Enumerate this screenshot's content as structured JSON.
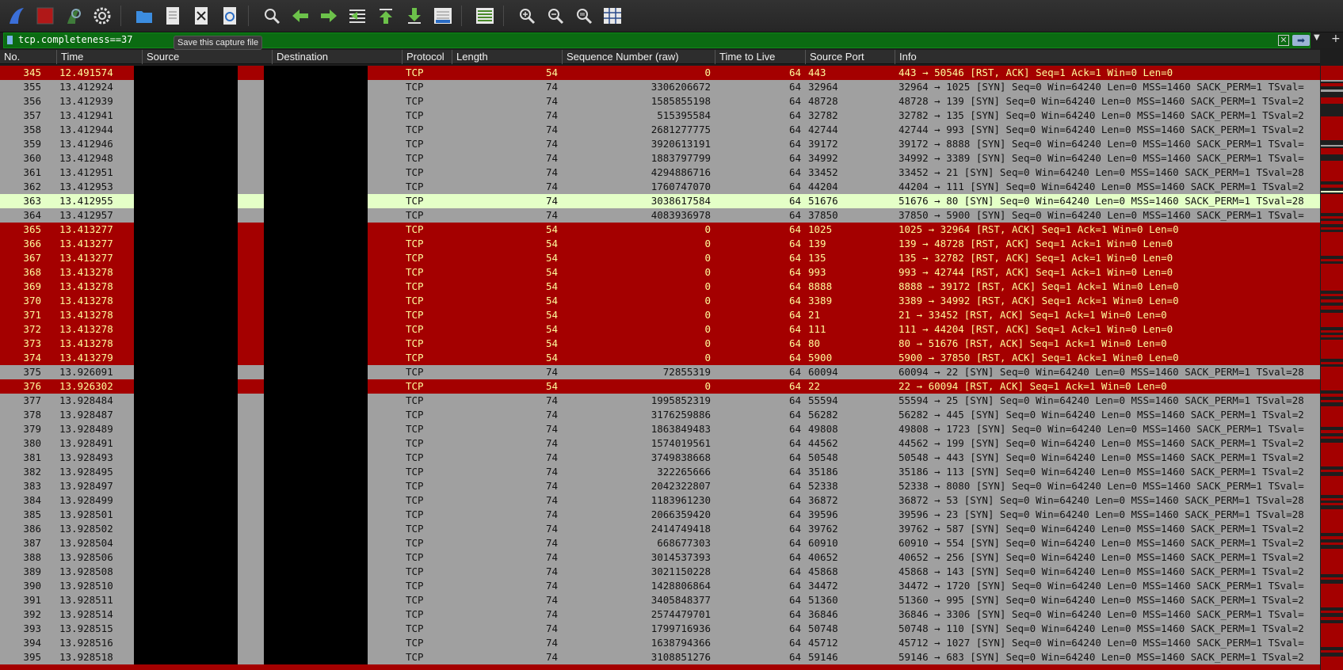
{
  "toolbar": {
    "tooltip": "Save this capture file",
    "icons": [
      "shark-fin-icon",
      "stop-icon",
      "restart-icon",
      "options-gear-icon",
      "open-folder-icon",
      "save-file-icon",
      "close-file-icon",
      "reload-icon",
      "find-icon",
      "back-arrow-icon",
      "forward-arrow-icon",
      "goto-packet-icon",
      "first-packet-icon",
      "last-packet-icon",
      "autoscroll-icon",
      "colorize-icon",
      "zoom-in-icon",
      "zoom-out-icon",
      "zoom-normal-icon",
      "resize-columns-icon"
    ]
  },
  "filter": {
    "value": "tcp.completeness==37"
  },
  "columns": [
    "No.",
    "Time",
    "Source",
    "Destination",
    "Protocol",
    "Length",
    "Sequence Number (raw)",
    "Time to Live",
    "Source Port",
    "Info"
  ],
  "colors": {
    "syn_bg": "#a0a0a0",
    "rst_bg": "#a40000",
    "rst_fg": "#fffc9c",
    "selected_bg": "#e4ffc7",
    "filter_bg": "#0b6b12"
  },
  "rows": [
    {
      "no": "345",
      "time": "12.491574",
      "proto": "TCP",
      "len": "54",
      "seq": "0",
      "ttl": "64",
      "sport": "443",
      "info": "443 → 50546 [RST, ACK] Seq=1 Ack=1 Win=0 Len=0",
      "type": "rst"
    },
    {
      "no": "355",
      "time": "13.412924",
      "proto": "TCP",
      "len": "74",
      "seq": "3306206672",
      "ttl": "64",
      "sport": "32964",
      "info": "32964 → 1025 [SYN] Seq=0 Win=64240 Len=0 MSS=1460 SACK_PERM=1 TSval=",
      "type": "syn"
    },
    {
      "no": "356",
      "time": "13.412939",
      "proto": "TCP",
      "len": "74",
      "seq": "1585855198",
      "ttl": "64",
      "sport": "48728",
      "info": "48728 → 139 [SYN] Seq=0 Win=64240 Len=0 MSS=1460 SACK_PERM=1 TSval=2",
      "type": "syn"
    },
    {
      "no": "357",
      "time": "13.412941",
      "proto": "TCP",
      "len": "74",
      "seq": "515395584",
      "ttl": "64",
      "sport": "32782",
      "info": "32782 → 135 [SYN] Seq=0 Win=64240 Len=0 MSS=1460 SACK_PERM=1 TSval=2",
      "type": "syn"
    },
    {
      "no": "358",
      "time": "13.412944",
      "proto": "TCP",
      "len": "74",
      "seq": "2681277775",
      "ttl": "64",
      "sport": "42744",
      "info": "42744 → 993 [SYN] Seq=0 Win=64240 Len=0 MSS=1460 SACK_PERM=1 TSval=2",
      "type": "syn"
    },
    {
      "no": "359",
      "time": "13.412946",
      "proto": "TCP",
      "len": "74",
      "seq": "3920613191",
      "ttl": "64",
      "sport": "39172",
      "info": "39172 → 8888 [SYN] Seq=0 Win=64240 Len=0 MSS=1460 SACK_PERM=1 TSval=",
      "type": "syn"
    },
    {
      "no": "360",
      "time": "13.412948",
      "proto": "TCP",
      "len": "74",
      "seq": "1883797799",
      "ttl": "64",
      "sport": "34992",
      "info": "34992 → 3389 [SYN] Seq=0 Win=64240 Len=0 MSS=1460 SACK_PERM=1 TSval=",
      "type": "syn"
    },
    {
      "no": "361",
      "time": "13.412951",
      "proto": "TCP",
      "len": "74",
      "seq": "4294886716",
      "ttl": "64",
      "sport": "33452",
      "info": "33452 → 21 [SYN] Seq=0 Win=64240 Len=0 MSS=1460 SACK_PERM=1 TSval=28",
      "type": "syn"
    },
    {
      "no": "362",
      "time": "13.412953",
      "proto": "TCP",
      "len": "74",
      "seq": "1760747070",
      "ttl": "64",
      "sport": "44204",
      "info": "44204 → 111 [SYN] Seq=0 Win=64240 Len=0 MSS=1460 SACK_PERM=1 TSval=2",
      "type": "syn"
    },
    {
      "no": "363",
      "time": "13.412955",
      "proto": "TCP",
      "len": "74",
      "seq": "3038617584",
      "ttl": "64",
      "sport": "51676",
      "info": "51676 → 80 [SYN] Seq=0 Win=64240 Len=0 MSS=1460 SACK_PERM=1 TSval=28",
      "type": "sel"
    },
    {
      "no": "364",
      "time": "13.412957",
      "proto": "TCP",
      "len": "74",
      "seq": "4083936978",
      "ttl": "64",
      "sport": "37850",
      "info": "37850 → 5900 [SYN] Seq=0 Win=64240 Len=0 MSS=1460 SACK_PERM=1 TSval=",
      "type": "syn"
    },
    {
      "no": "365",
      "time": "13.413277",
      "proto": "TCP",
      "len": "54",
      "seq": "0",
      "ttl": "64",
      "sport": "1025",
      "info": "1025 → 32964 [RST, ACK] Seq=1 Ack=1 Win=0 Len=0",
      "type": "rst"
    },
    {
      "no": "366",
      "time": "13.413277",
      "proto": "TCP",
      "len": "54",
      "seq": "0",
      "ttl": "64",
      "sport": "139",
      "info": "139 → 48728 [RST, ACK] Seq=1 Ack=1 Win=0 Len=0",
      "type": "rst"
    },
    {
      "no": "367",
      "time": "13.413277",
      "proto": "TCP",
      "len": "54",
      "seq": "0",
      "ttl": "64",
      "sport": "135",
      "info": "135 → 32782 [RST, ACK] Seq=1 Ack=1 Win=0 Len=0",
      "type": "rst"
    },
    {
      "no": "368",
      "time": "13.413278",
      "proto": "TCP",
      "len": "54",
      "seq": "0",
      "ttl": "64",
      "sport": "993",
      "info": "993 → 42744 [RST, ACK] Seq=1 Ack=1 Win=0 Len=0",
      "type": "rst"
    },
    {
      "no": "369",
      "time": "13.413278",
      "proto": "TCP",
      "len": "54",
      "seq": "0",
      "ttl": "64",
      "sport": "8888",
      "info": "8888 → 39172 [RST, ACK] Seq=1 Ack=1 Win=0 Len=0",
      "type": "rst"
    },
    {
      "no": "370",
      "time": "13.413278",
      "proto": "TCP",
      "len": "54",
      "seq": "0",
      "ttl": "64",
      "sport": "3389",
      "info": "3389 → 34992 [RST, ACK] Seq=1 Ack=1 Win=0 Len=0",
      "type": "rst"
    },
    {
      "no": "371",
      "time": "13.413278",
      "proto": "TCP",
      "len": "54",
      "seq": "0",
      "ttl": "64",
      "sport": "21",
      "info": "21 → 33452 [RST, ACK] Seq=1 Ack=1 Win=0 Len=0",
      "type": "rst"
    },
    {
      "no": "372",
      "time": "13.413278",
      "proto": "TCP",
      "len": "54",
      "seq": "0",
      "ttl": "64",
      "sport": "111",
      "info": "111 → 44204 [RST, ACK] Seq=1 Ack=1 Win=0 Len=0",
      "type": "rst"
    },
    {
      "no": "373",
      "time": "13.413278",
      "proto": "TCP",
      "len": "54",
      "seq": "0",
      "ttl": "64",
      "sport": "80",
      "info": "80 → 51676 [RST, ACK] Seq=1 Ack=1 Win=0 Len=0",
      "type": "rst"
    },
    {
      "no": "374",
      "time": "13.413279",
      "proto": "TCP",
      "len": "54",
      "seq": "0",
      "ttl": "64",
      "sport": "5900",
      "info": "5900 → 37850 [RST, ACK] Seq=1 Ack=1 Win=0 Len=0",
      "type": "rst"
    },
    {
      "no": "375",
      "time": "13.926091",
      "proto": "TCP",
      "len": "74",
      "seq": "72855319",
      "ttl": "64",
      "sport": "60094",
      "info": "60094 → 22 [SYN] Seq=0 Win=64240 Len=0 MSS=1460 SACK_PERM=1 TSval=28",
      "type": "syn"
    },
    {
      "no": "376",
      "time": "13.926302",
      "proto": "TCP",
      "len": "54",
      "seq": "0",
      "ttl": "64",
      "sport": "22",
      "info": "22 → 60094 [RST, ACK] Seq=1 Ack=1 Win=0 Len=0",
      "type": "rst"
    },
    {
      "no": "377",
      "time": "13.928484",
      "proto": "TCP",
      "len": "74",
      "seq": "1995852319",
      "ttl": "64",
      "sport": "55594",
      "info": "55594 → 25 [SYN] Seq=0 Win=64240 Len=0 MSS=1460 SACK_PERM=1 TSval=28",
      "type": "syn"
    },
    {
      "no": "378",
      "time": "13.928487",
      "proto": "TCP",
      "len": "74",
      "seq": "3176259886",
      "ttl": "64",
      "sport": "56282",
      "info": "56282 → 445 [SYN] Seq=0 Win=64240 Len=0 MSS=1460 SACK_PERM=1 TSval=2",
      "type": "syn"
    },
    {
      "no": "379",
      "time": "13.928489",
      "proto": "TCP",
      "len": "74",
      "seq": "1863849483",
      "ttl": "64",
      "sport": "49808",
      "info": "49808 → 1723 [SYN] Seq=0 Win=64240 Len=0 MSS=1460 SACK_PERM=1 TSval=",
      "type": "syn"
    },
    {
      "no": "380",
      "time": "13.928491",
      "proto": "TCP",
      "len": "74",
      "seq": "1574019561",
      "ttl": "64",
      "sport": "44562",
      "info": "44562 → 199 [SYN] Seq=0 Win=64240 Len=0 MSS=1460 SACK_PERM=1 TSval=2",
      "type": "syn"
    },
    {
      "no": "381",
      "time": "13.928493",
      "proto": "TCP",
      "len": "74",
      "seq": "3749838668",
      "ttl": "64",
      "sport": "50548",
      "info": "50548 → 443 [SYN] Seq=0 Win=64240 Len=0 MSS=1460 SACK_PERM=1 TSval=2",
      "type": "syn"
    },
    {
      "no": "382",
      "time": "13.928495",
      "proto": "TCP",
      "len": "74",
      "seq": "322265666",
      "ttl": "64",
      "sport": "35186",
      "info": "35186 → 113 [SYN] Seq=0 Win=64240 Len=0 MSS=1460 SACK_PERM=1 TSval=2",
      "type": "syn"
    },
    {
      "no": "383",
      "time": "13.928497",
      "proto": "TCP",
      "len": "74",
      "seq": "2042322807",
      "ttl": "64",
      "sport": "52338",
      "info": "52338 → 8080 [SYN] Seq=0 Win=64240 Len=0 MSS=1460 SACK_PERM=1 TSval=",
      "type": "syn"
    },
    {
      "no": "384",
      "time": "13.928499",
      "proto": "TCP",
      "len": "74",
      "seq": "1183961230",
      "ttl": "64",
      "sport": "36872",
      "info": "36872 → 53 [SYN] Seq=0 Win=64240 Len=0 MSS=1460 SACK_PERM=1 TSval=28",
      "type": "syn"
    },
    {
      "no": "385",
      "time": "13.928501",
      "proto": "TCP",
      "len": "74",
      "seq": "2066359420",
      "ttl": "64",
      "sport": "39596",
      "info": "39596 → 23 [SYN] Seq=0 Win=64240 Len=0 MSS=1460 SACK_PERM=1 TSval=28",
      "type": "syn"
    },
    {
      "no": "386",
      "time": "13.928502",
      "proto": "TCP",
      "len": "74",
      "seq": "2414749418",
      "ttl": "64",
      "sport": "39762",
      "info": "39762 → 587 [SYN] Seq=0 Win=64240 Len=0 MSS=1460 SACK_PERM=1 TSval=2",
      "type": "syn"
    },
    {
      "no": "387",
      "time": "13.928504",
      "proto": "TCP",
      "len": "74",
      "seq": "668677303",
      "ttl": "64",
      "sport": "60910",
      "info": "60910 → 554 [SYN] Seq=0 Win=64240 Len=0 MSS=1460 SACK_PERM=1 TSval=2",
      "type": "syn"
    },
    {
      "no": "388",
      "time": "13.928506",
      "proto": "TCP",
      "len": "74",
      "seq": "3014537393",
      "ttl": "64",
      "sport": "40652",
      "info": "40652 → 256 [SYN] Seq=0 Win=64240 Len=0 MSS=1460 SACK_PERM=1 TSval=2",
      "type": "syn"
    },
    {
      "no": "389",
      "time": "13.928508",
      "proto": "TCP",
      "len": "74",
      "seq": "3021150228",
      "ttl": "64",
      "sport": "45868",
      "info": "45868 → 143 [SYN] Seq=0 Win=64240 Len=0 MSS=1460 SACK_PERM=1 TSval=2",
      "type": "syn"
    },
    {
      "no": "390",
      "time": "13.928510",
      "proto": "TCP",
      "len": "74",
      "seq": "1428806864",
      "ttl": "64",
      "sport": "34472",
      "info": "34472 → 1720 [SYN] Seq=0 Win=64240 Len=0 MSS=1460 SACK_PERM=1 TSval=",
      "type": "syn"
    },
    {
      "no": "391",
      "time": "13.928511",
      "proto": "TCP",
      "len": "74",
      "seq": "3405848377",
      "ttl": "64",
      "sport": "51360",
      "info": "51360 → 995 [SYN] Seq=0 Win=64240 Len=0 MSS=1460 SACK_PERM=1 TSval=2",
      "type": "syn"
    },
    {
      "no": "392",
      "time": "13.928514",
      "proto": "TCP",
      "len": "74",
      "seq": "2574479701",
      "ttl": "64",
      "sport": "36846",
      "info": "36846 → 3306 [SYN] Seq=0 Win=64240 Len=0 MSS=1460 SACK_PERM=1 TSval=",
      "type": "syn"
    },
    {
      "no": "393",
      "time": "13.928515",
      "proto": "TCP",
      "len": "74",
      "seq": "1799716936",
      "ttl": "64",
      "sport": "50748",
      "info": "50748 → 110 [SYN] Seq=0 Win=64240 Len=0 MSS=1460 SACK_PERM=1 TSval=2",
      "type": "syn"
    },
    {
      "no": "394",
      "time": "13.928516",
      "proto": "TCP",
      "len": "74",
      "seq": "1638794366",
      "ttl": "64",
      "sport": "45712",
      "info": "45712 → 1027 [SYN] Seq=0 Win=64240 Len=0 MSS=1460 SACK_PERM=1 TSval=",
      "type": "syn"
    },
    {
      "no": "395",
      "time": "13.928518",
      "proto": "TCP",
      "len": "74",
      "seq": "3108851276",
      "ttl": "64",
      "sport": "59146",
      "info": "59146 → 683 [SYN] Seq=0 Win=64240 Len=0 MSS=1460 SACK_PERM=1 TSval=2",
      "type": "syn"
    }
  ]
}
